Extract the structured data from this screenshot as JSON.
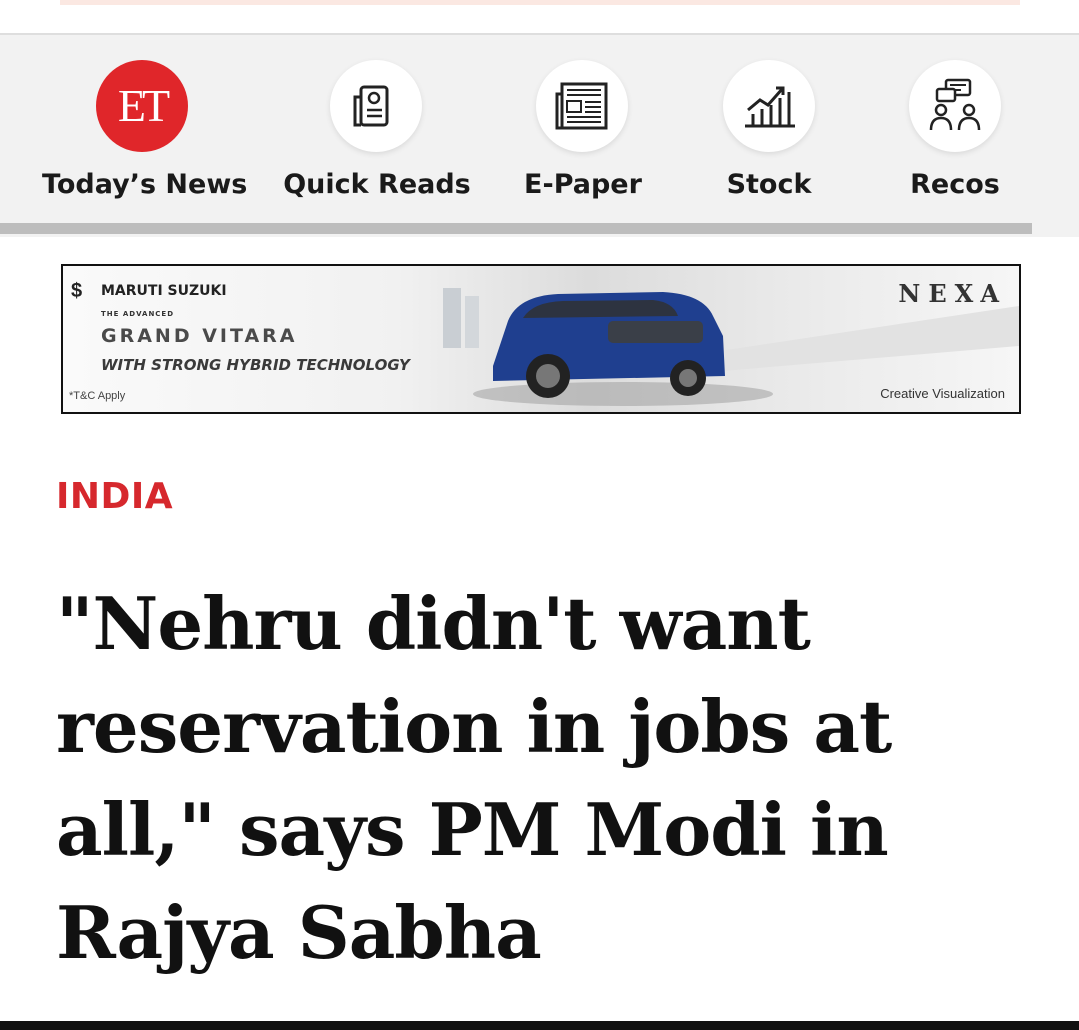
{
  "nav": {
    "items": [
      {
        "label": "Today’s News",
        "icon": "et-logo-icon",
        "logo_text": "ET"
      },
      {
        "label": "Quick Reads",
        "icon": "quick-reads-icon"
      },
      {
        "label": "E-Paper",
        "icon": "newspaper-icon"
      },
      {
        "label": "Stock",
        "icon": "stock-chart-icon"
      },
      {
        "label": "Recos",
        "icon": "recos-people-icon"
      }
    ]
  },
  "ad": {
    "brand": "MARUTI SUZUKI",
    "tagline": "THE ADVANCED",
    "model": "GRAND VITARA",
    "subtitle": "WITH STRONG HYBRID TECHNOLOGY",
    "terms": "*T&C Apply",
    "nexa": "NEXA",
    "visual_note": "Creative Visualization"
  },
  "article": {
    "category": "INDIA",
    "headline": "\"Nehru didn't want reservation in jobs at all,\" says PM Modi in Rajya Sabha"
  },
  "colors": {
    "accent": "#d6282d",
    "et_logo_bg": "#e0262a",
    "nav_bg": "#f2f2f2"
  }
}
